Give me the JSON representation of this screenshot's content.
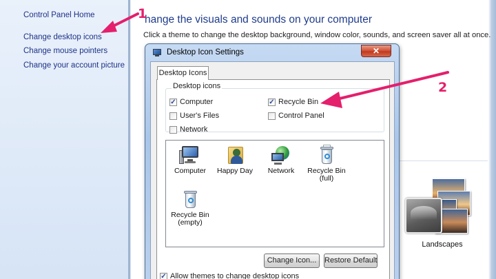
{
  "left_pane": {
    "home": "Control Panel Home",
    "links": [
      "Change desktop icons",
      "Change mouse pointers",
      "Change your account picture"
    ]
  },
  "main": {
    "heading": "hange the visuals and sounds on your computer",
    "description": "Click a theme to change the desktop background, window color, sounds, and screen saver all at once."
  },
  "theme": {
    "label": "Landscapes"
  },
  "dialog": {
    "title": "Desktop Icon Settings",
    "close_label": "✕",
    "tab": "Desktop Icons",
    "group_title": "Desktop icons",
    "checkboxes": [
      {
        "label": "Computer",
        "checked": true
      },
      {
        "label": "User's Files",
        "checked": false
      },
      {
        "label": "Network",
        "checked": false
      },
      {
        "label": "Recycle Bin",
        "checked": true
      },
      {
        "label": "Control Panel",
        "checked": false
      }
    ],
    "icons": [
      {
        "line1": "Computer",
        "line2": "",
        "icon": "computer-icon"
      },
      {
        "line1": "Happy Day",
        "line2": "",
        "icon": "user-folder-icon"
      },
      {
        "line1": "Network",
        "line2": "",
        "icon": "network-icon"
      },
      {
        "line1": "Recycle Bin",
        "line2": "(full)",
        "icon": "recycle-bin-full-icon"
      },
      {
        "line1": "Recycle Bin",
        "line2": "(empty)",
        "icon": "recycle-bin-empty-icon"
      }
    ],
    "change_icon_button": "Change Icon...",
    "restore_default_button": "Restore Default",
    "allow_themes": {
      "label": "Allow themes to change desktop icons",
      "checked": true
    }
  },
  "annotations": {
    "marker_1": "1",
    "marker_2": "2",
    "color": "#e41f6c"
  }
}
